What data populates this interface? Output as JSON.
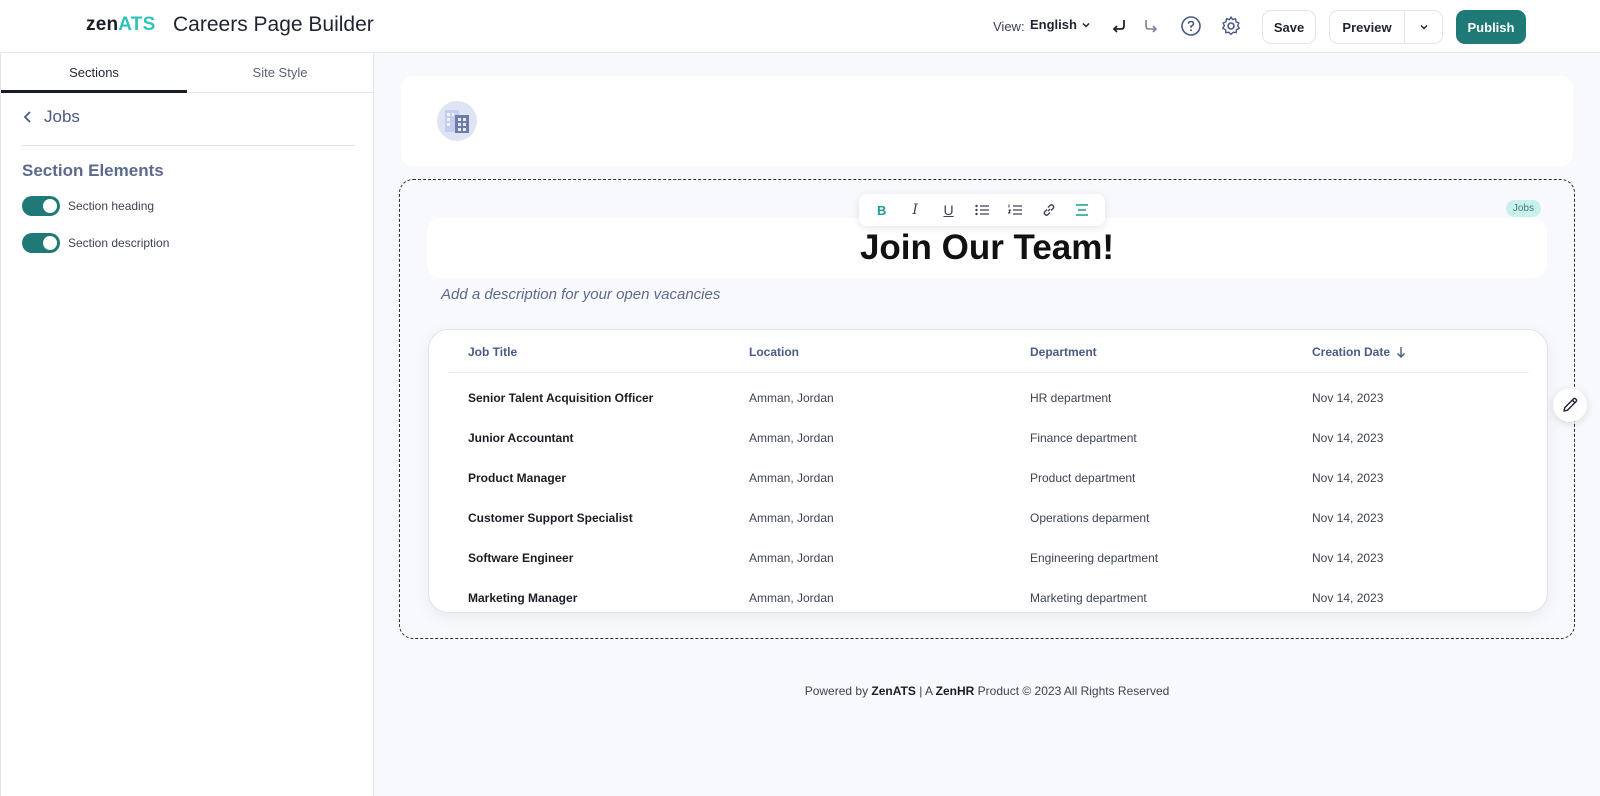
{
  "header": {
    "logo_zen": "zen",
    "logo_ats": "ATS",
    "title": "Careers Page Builder",
    "view_label": "View:",
    "view_value": "English",
    "save_label": "Save",
    "preview_label": "Preview",
    "publish_label": "Publish"
  },
  "sidebar": {
    "tabs": [
      {
        "label": "Sections",
        "active": true
      },
      {
        "label": "Site Style",
        "active": false
      }
    ],
    "back_title": "Jobs",
    "section_elements_title": "Section Elements",
    "toggles": [
      {
        "label": "Section heading",
        "on": true
      },
      {
        "label": "Section description",
        "on": true
      }
    ]
  },
  "canvas": {
    "jobs_badge": "Jobs",
    "heading": "Join Our Team!",
    "description_placeholder": "Add a description for your open vacancies",
    "toolbar": [
      "bold-icon",
      "italic-icon",
      "underline-icon",
      "bullet-list-icon",
      "numbered-list-icon",
      "link-icon",
      "align-center-icon"
    ],
    "table": {
      "columns": [
        "Job Title",
        "Location",
        "Department",
        "Creation Date"
      ],
      "sort_column": "Creation Date",
      "sort_direction": "desc",
      "rows": [
        {
          "title": "Senior Talent Acquisition Officer",
          "location": "Amman, Jordan",
          "department": "HR department",
          "date": "Nov 14, 2023"
        },
        {
          "title": "Junior Accountant",
          "location": "Amman, Jordan",
          "department": "Finance department",
          "date": "Nov 14, 2023"
        },
        {
          "title": "Product Manager",
          "location": "Amman, Jordan",
          "department": "Product department",
          "date": "Nov 14, 2023"
        },
        {
          "title": "Customer Support Specialist",
          "location": "Amman, Jordan",
          "department": "Operations deparment",
          "date": "Nov 14, 2023"
        },
        {
          "title": "Software Engineer",
          "location": "Amman, Jordan",
          "department": "Engineering department",
          "date": "Nov 14, 2023"
        },
        {
          "title": "Marketing Manager",
          "location": "Amman, Jordan",
          "department": "Marketing department",
          "date": "Nov 14, 2023"
        }
      ]
    }
  },
  "footer": {
    "powered_by": "Powered by ",
    "brand": "ZenATS",
    "sep": " | A ",
    "parent_brand": "ZenHR",
    "rest": " Product © 2023 All Rights Reserved"
  },
  "colors": {
    "accent": "#1f7a77",
    "brand_teal": "#2fc4b8",
    "muted_blue": "#5b6a8e"
  }
}
